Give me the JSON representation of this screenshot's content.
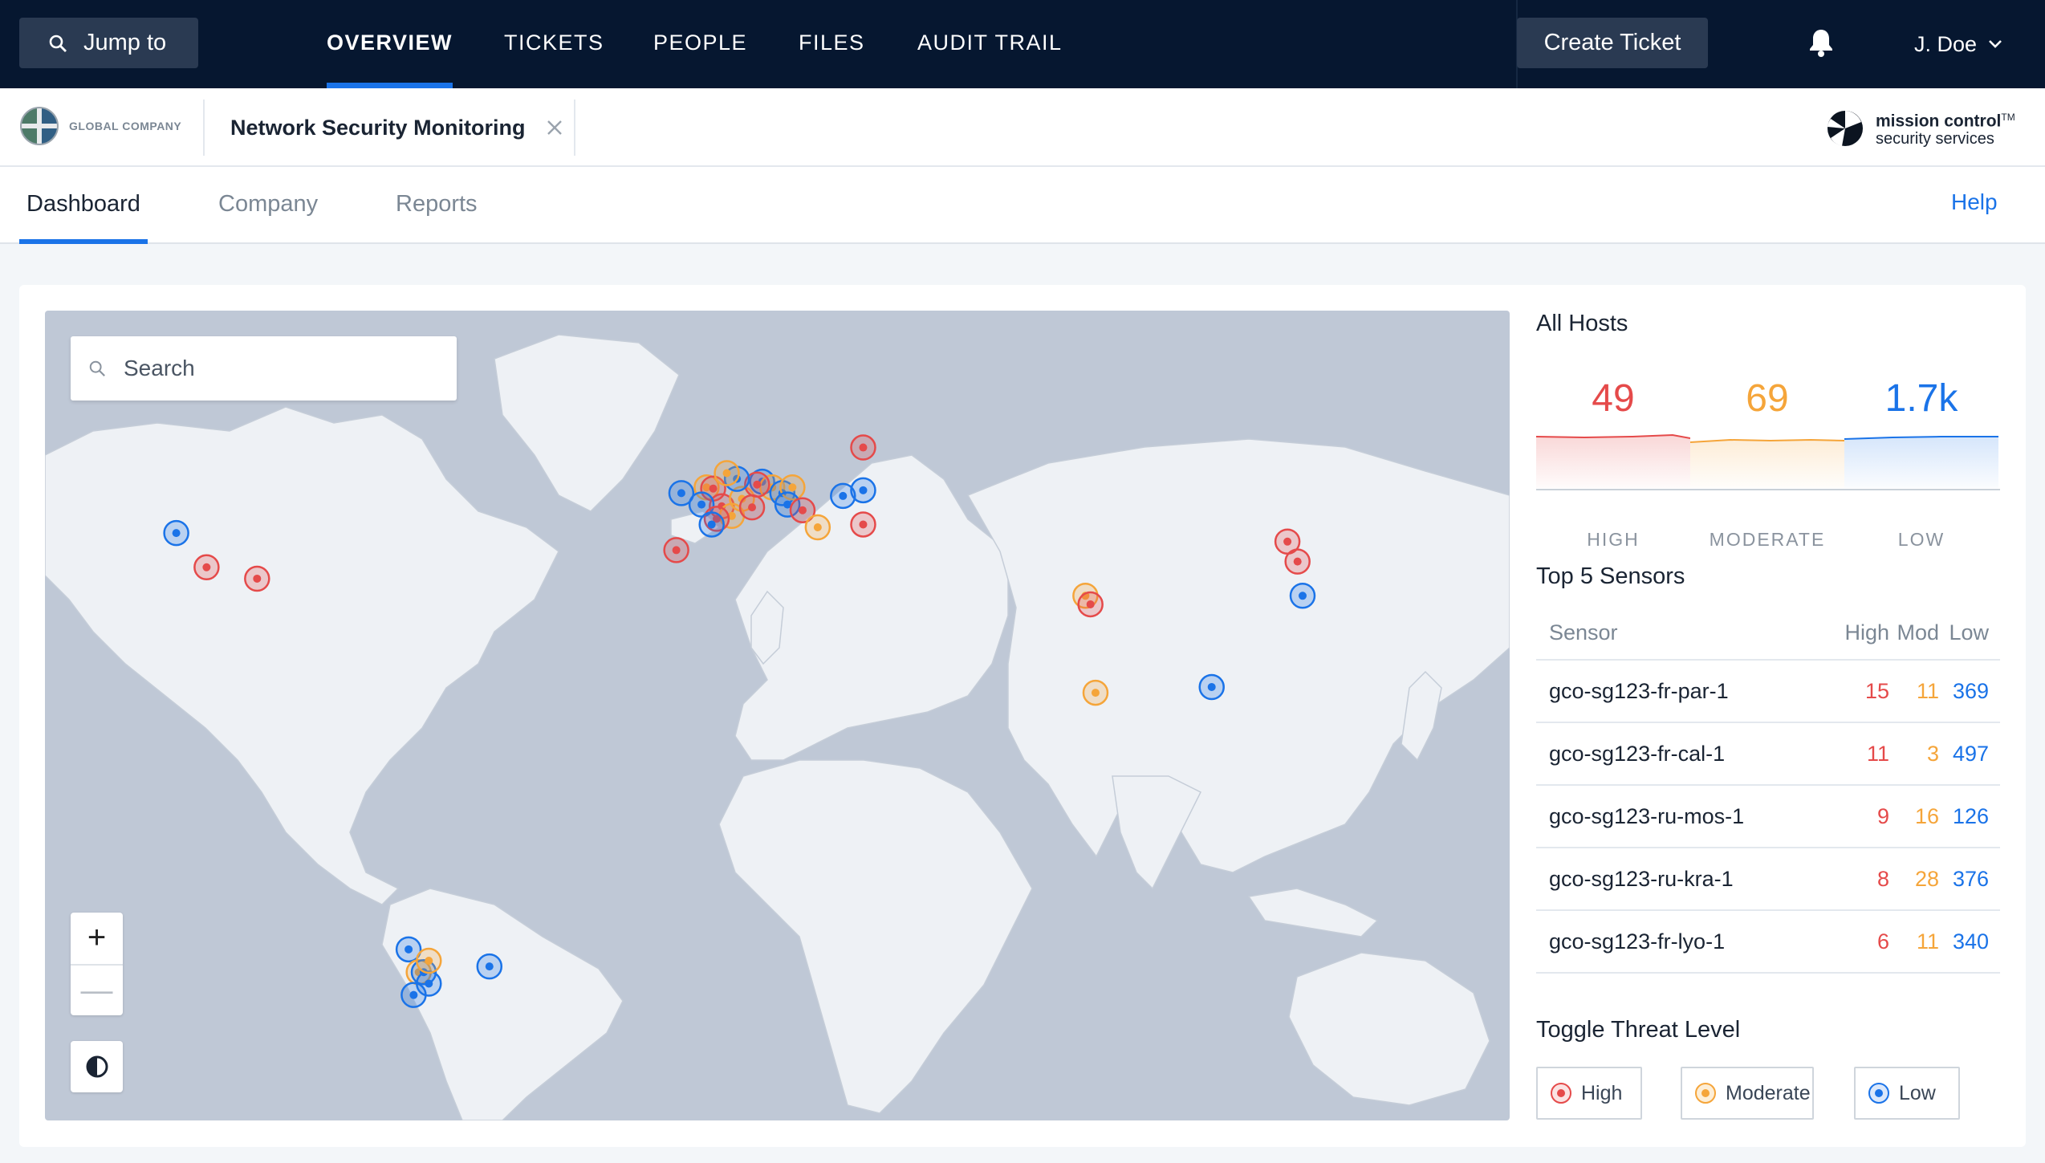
{
  "topnav": {
    "jump_label": "Jump to",
    "items": [
      "OVERVIEW",
      "TICKETS",
      "PEOPLE",
      "FILES",
      "AUDIT TRAIL"
    ],
    "active": "OVERVIEW",
    "create_label": "Create Ticket",
    "user": "J. Doe"
  },
  "company_bar": {
    "logo_text": "GLOBAL COMPANY",
    "tab_title": "Network Security Monitoring",
    "brand_name": "mission control",
    "brand_mark": "TM",
    "brand_sub": "security services"
  },
  "subtabs": {
    "items": [
      "Dashboard",
      "Company",
      "Reports"
    ],
    "active": "Dashboard",
    "help": "Help"
  },
  "map": {
    "search_placeholder": "Search",
    "zoom_in": "+",
    "zoom_out": "—",
    "markers": [
      {
        "level": "low",
        "lon": -104,
        "lat": 41
      },
      {
        "level": "high",
        "lon": -98,
        "lat": 35
      },
      {
        "level": "high",
        "lon": -88,
        "lat": 33
      },
      {
        "level": "low",
        "lon": -4,
        "lat": 48
      },
      {
        "level": "moderate",
        "lon": 1,
        "lat": 49
      },
      {
        "level": "high",
        "lon": 2.3,
        "lat": 48.8
      },
      {
        "level": "high",
        "lon": 4,
        "lat": 45.7
      },
      {
        "level": "low",
        "lon": 0,
        "lat": 46
      },
      {
        "level": "moderate",
        "lon": 6,
        "lat": 44
      },
      {
        "level": "high",
        "lon": 3,
        "lat": 43.5
      },
      {
        "level": "low",
        "lon": 2,
        "lat": 42.5
      },
      {
        "level": "moderate",
        "lon": 8,
        "lat": 47
      },
      {
        "level": "high",
        "lon": 10,
        "lat": 45.5
      },
      {
        "level": "low",
        "lon": 12,
        "lat": 50
      },
      {
        "level": "moderate",
        "lon": 14,
        "lat": 49
      },
      {
        "level": "high",
        "lon": 11,
        "lat": 49.5
      },
      {
        "level": "low",
        "lon": 7,
        "lat": 50.5
      },
      {
        "level": "moderate",
        "lon": 5,
        "lat": 51.5
      },
      {
        "level": "low",
        "lon": 16,
        "lat": 48
      },
      {
        "level": "moderate",
        "lon": 18,
        "lat": 49
      },
      {
        "level": "low",
        "lon": 17,
        "lat": 46
      },
      {
        "level": "high",
        "lon": 20,
        "lat": 45
      },
      {
        "level": "moderate",
        "lon": 23,
        "lat": 42
      },
      {
        "level": "high",
        "lon": -5,
        "lat": 38
      },
      {
        "level": "low",
        "lon": 28,
        "lat": 47.5
      },
      {
        "level": "low",
        "lon": 32,
        "lat": 48.5
      },
      {
        "level": "high",
        "lon": 32,
        "lat": 56
      },
      {
        "level": "high",
        "lon": 32,
        "lat": 42.5
      },
      {
        "level": "moderate",
        "lon": 76,
        "lat": 30
      },
      {
        "level": "high",
        "lon": 77,
        "lat": 28.5
      },
      {
        "level": "moderate",
        "lon": 78,
        "lat": 13
      },
      {
        "level": "low",
        "lon": 101,
        "lat": 14
      },
      {
        "level": "high",
        "lon": 116,
        "lat": 39.5
      },
      {
        "level": "high",
        "lon": 118,
        "lat": 36
      },
      {
        "level": "low",
        "lon": 119,
        "lat": 30
      },
      {
        "level": "low",
        "lon": -58,
        "lat": -32
      },
      {
        "level": "moderate",
        "lon": -56,
        "lat": -36
      },
      {
        "level": "low",
        "lon": -54,
        "lat": -38
      },
      {
        "level": "low",
        "lon": -57,
        "lat": -40
      },
      {
        "level": "low",
        "lon": -42,
        "lat": -35
      },
      {
        "level": "low",
        "lon": -55,
        "lat": -36
      },
      {
        "level": "moderate",
        "lon": -54,
        "lat": -34
      }
    ]
  },
  "all_hosts": {
    "title": "All Hosts",
    "high": {
      "value": "49",
      "label": "HIGH"
    },
    "moderate": {
      "value": "69",
      "label": "MODERATE"
    },
    "low": {
      "value": "1.7k",
      "label": "LOW"
    }
  },
  "sensors": {
    "title": "Top 5 Sensors",
    "columns": [
      "Sensor",
      "High",
      "Mod",
      "Low"
    ],
    "rows": [
      {
        "name": "gco-sg123-fr-par-1",
        "high": "15",
        "mod": "11",
        "low": "369"
      },
      {
        "name": "gco-sg123-fr-cal-1",
        "high": "11",
        "mod": "3",
        "low": "497"
      },
      {
        "name": "gco-sg123-ru-mos-1",
        "high": "9",
        "mod": "16",
        "low": "126"
      },
      {
        "name": "gco-sg123-ru-kra-1",
        "high": "8",
        "mod": "28",
        "low": "376"
      },
      {
        "name": "gco-sg123-fr-lyo-1",
        "high": "6",
        "mod": "11",
        "low": "340"
      }
    ]
  },
  "toggle": {
    "title": "Toggle Threat Level",
    "buttons": [
      "High",
      "Moderate",
      "Low"
    ]
  },
  "colors": {
    "nav_bg": "#061730",
    "accent": "#1a73e8",
    "high": "#e54a4a",
    "moderate": "#f5a53a",
    "low": "#1a73e8",
    "map_water": "#bfc8d6",
    "map_land": "#eef1f5"
  }
}
